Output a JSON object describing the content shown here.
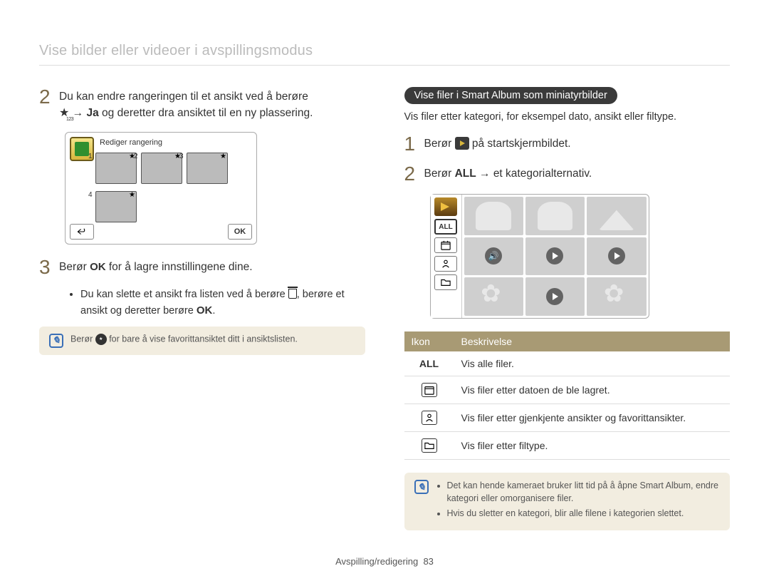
{
  "header": {
    "title": "Vise bilder eller videoer i avspillingsmodus"
  },
  "left": {
    "step2": {
      "line1": "Du kan endre rangeringen til et ansikt ved å berøre",
      "line2a": "→ ",
      "ja": "Ja",
      "line2b": " og deretter dra ansiktet til en ny plassering."
    },
    "editor": {
      "title": "Rediger rangering",
      "nums": [
        "1",
        "2",
        "3",
        "4"
      ],
      "ok": "OK"
    },
    "step3": {
      "text_a": "Berør ",
      "ok": "OK",
      "text_b": " for å lagre innstillingene dine."
    },
    "bullet": {
      "a": "Du kan slette et ansikt fra listen ved å berøre ",
      "b": ", berøre et ansikt og deretter berøre ",
      "c": "."
    },
    "note": {
      "a": "Berør ",
      "b": " for bare å vise favorittansiktet ditt i ansiktslisten."
    }
  },
  "right": {
    "section_title": "Vise filer i Smart Album som miniatyrbilder",
    "section_sub": "Vis filer etter kategori, for eksempel dato, ansikt eller filtype.",
    "step1": {
      "a": "Berør ",
      "b": " på startskjermbildet."
    },
    "step2": {
      "a": "Berør ",
      "all": "ALL",
      "b": " → et kategorialternativ."
    },
    "sidebar": {
      "all": "ALL"
    },
    "table": {
      "h1": "Ikon",
      "h2": "Beskrivelse",
      "rows": [
        {
          "icon": "ALL",
          "desc": "Vis alle filer."
        },
        {
          "icon": "calendar",
          "desc": "Vis filer etter datoen de ble lagret."
        },
        {
          "icon": "person",
          "desc": "Vis filer etter gjenkjente ansikter og favorittansikter."
        },
        {
          "icon": "folder",
          "desc": "Vis filer etter filtype."
        }
      ]
    },
    "note": {
      "li1": "Det kan hende kameraet bruker litt tid på å åpne Smart Album, endre kategori eller omorganisere filer.",
      "li2": "Hvis du sletter en kategori, blir alle filene i kategorien slettet."
    }
  },
  "footer": {
    "section": "Avspilling/redigering",
    "page": "83"
  }
}
